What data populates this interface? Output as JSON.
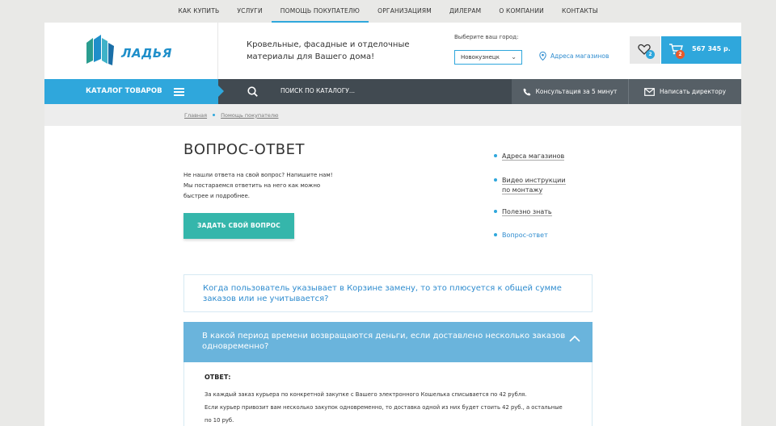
{
  "topnav": [
    "КАК КУПИТЬ",
    "УСЛУГИ",
    "ПОМОЩЬ ПОКУПАТЕЛЮ",
    "ОРГАНИЗАЦИЯМ",
    "ДИЛЕРАМ",
    "О КОМПАНИИ",
    "КОНТАКТЫ"
  ],
  "header": {
    "logo": "ЛАДЬЯ",
    "tagline": "Кровельные, фасадные и отделочные материалы для Вашего дома!",
    "city_label": "Выберите ваш город:",
    "city_value": "Новокузнецк",
    "stores_link": "Адреса магазинов",
    "fav_count": "2",
    "cart_count": "2",
    "cart_total": "567 345 р."
  },
  "bar": {
    "catalog": "КАТАЛОГ ТОВАРОВ",
    "search_placeholder": "ПОИСК ПО КАТАЛОГУ...",
    "consult": "Консультация за 5 минут",
    "director": "Написать директору"
  },
  "breadcrumbs": [
    "Главная",
    "Помощь покупателю"
  ],
  "main": {
    "title": "ВОПРОС-ОТВЕТ",
    "intro": [
      "Не нашли ответа на свой вопрос? Напишите нам!",
      "Мы постараемся ответить на него как можно",
      "быстрее и подробнее."
    ],
    "ask_button": "ЗАДАТЬ СВОЙ ВОПРОС"
  },
  "side": [
    {
      "label": "Адреса магазинов"
    },
    {
      "label": "Видео инструкции по монтажу"
    },
    {
      "label": "Полезно знать"
    },
    {
      "label": "Вопрос-ответ"
    }
  ],
  "faq": {
    "q1": "Когда пользователь указывает в Корзине замену, то это плюсуется к общей сумме заказов или не учитывается?",
    "q2": "В какой период времени возвращаются деньги, если доставлено несколько заказов одновременно?",
    "answer_label": "ОТВЕТ:",
    "answer_lines": [
      "За каждый заказ курьера по конкретной закупке с Вашего электронного Кошелька списывается по 42 рубля.",
      "Если курьер привозит вам несколько закупок одновременно, то доставка одной из них будет стоить 42 руб., а остальные",
      "по 10 руб."
    ]
  },
  "colors": {
    "accent": "#2fa7dc",
    "button": "#35b6ab",
    "dark": "#414a51"
  }
}
